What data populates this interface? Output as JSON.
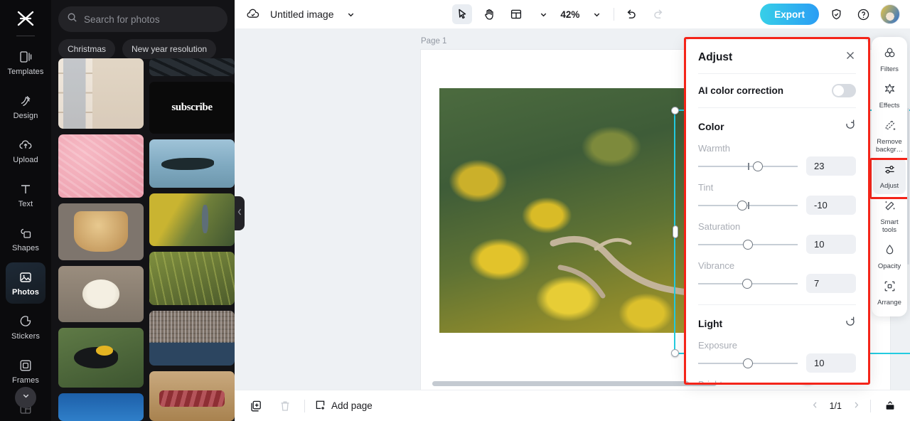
{
  "brand": {
    "logo_icon": "capcut-logo-icon"
  },
  "sidebar": {
    "items": [
      {
        "label": "Templates",
        "icon": "templates-icon",
        "active": false
      },
      {
        "label": "Design",
        "icon": "design-icon",
        "active": false
      },
      {
        "label": "Upload",
        "icon": "upload-cloud-icon",
        "active": false
      },
      {
        "label": "Text",
        "icon": "text-icon",
        "active": false
      },
      {
        "label": "Shapes",
        "icon": "shapes-icon",
        "active": false
      },
      {
        "label": "Photos",
        "icon": "photos-icon",
        "active": true
      },
      {
        "label": "Stickers",
        "icon": "stickers-icon",
        "active": false
      },
      {
        "label": "Frames",
        "icon": "frames-icon",
        "active": false
      }
    ],
    "more_icon": "chevron-down-icon"
  },
  "photo_panel": {
    "search": {
      "placeholder": "Search for photos",
      "icon": "search-icon"
    },
    "chips": [
      "Christmas",
      "New year resolution"
    ],
    "thumbnails_left": [
      {
        "name": "closet-wardrobe-photo"
      },
      {
        "name": "pink-texture-photo"
      },
      {
        "name": "bread-basket-photo"
      },
      {
        "name": "hummus-bowl-photo"
      },
      {
        "name": "oriole-bird-photo"
      },
      {
        "name": "blue-photo"
      }
    ],
    "thumbnails_right": [
      {
        "name": "keyboard-photo"
      },
      {
        "name": "subscribe-photo",
        "caption": "subscribe"
      },
      {
        "name": "cormorant-flying-photo"
      },
      {
        "name": "heron-branch-photo"
      },
      {
        "name": "reed-bird-photo"
      },
      {
        "name": "coastal-city-photo"
      },
      {
        "name": "salami-bread-photo"
      }
    ],
    "collapse_icon": "chevron-left-icon"
  },
  "topbar": {
    "cloud_icon": "cloud-saved-icon",
    "document_title": "Untitled image",
    "title_caret": "chevron-down-icon",
    "tools": [
      {
        "name": "select-tool",
        "icon": "cursor-arrow-icon",
        "active": true
      },
      {
        "name": "hand-tool",
        "icon": "hand-icon",
        "active": false
      },
      {
        "name": "layout-tool",
        "icon": "layout-icon",
        "active": false
      }
    ],
    "layout_caret": "chevron-down-icon",
    "zoom_level": "42%",
    "zoom_caret": "chevron-down-icon",
    "undo_icon": "undo-icon",
    "redo_icon": "redo-icon",
    "export_label": "Export",
    "shield_icon": "shield-check-icon",
    "help_icon": "help-circle-icon",
    "avatar": "user-avatar"
  },
  "canvas": {
    "page_label": "Page 1",
    "selected_image": "great-blue-heron-on-branch",
    "selection_color": "#23cbe0",
    "float_toolbar": [
      {
        "name": "crop-button",
        "icon": "crop-icon"
      },
      {
        "name": "replace-button",
        "icon": "replace-image-icon"
      },
      {
        "name": "duplicate-button",
        "icon": "duplicate-icon"
      },
      {
        "name": "more-button",
        "icon": "more-horizontal-icon"
      }
    ],
    "rotate_icon": "rotate-icon"
  },
  "adjust_panel": {
    "title": "Adjust",
    "close_icon": "close-icon",
    "highlight_color": "#f42419",
    "ai_color_correction": {
      "label": "AI color correction",
      "enabled": false
    },
    "sections": [
      {
        "title": "Color",
        "reset_icon": "reset-icon",
        "controls": [
          {
            "label": "Warmth",
            "value": "23",
            "pos": 60,
            "tick": true
          },
          {
            "label": "Tint",
            "value": "-10",
            "pos": 44,
            "tick": true
          },
          {
            "label": "Saturation",
            "value": "10",
            "pos": 50,
            "tick": false
          },
          {
            "label": "Vibrance",
            "value": "7",
            "pos": 49,
            "tick": false
          }
        ]
      },
      {
        "title": "Light",
        "reset_icon": "reset-icon",
        "controls": [
          {
            "label": "Exposure",
            "value": "10",
            "pos": 50,
            "tick": false
          },
          {
            "label": "Brightness",
            "value": "",
            "pos": 50,
            "tick": false
          }
        ]
      }
    ]
  },
  "right_toolbar": {
    "items": [
      {
        "label": "Filters",
        "icon": "filters-icon",
        "active": false
      },
      {
        "label": "Effects",
        "icon": "effects-icon",
        "active": false
      },
      {
        "label": "Remove\nbackgr…",
        "icon": "remove-bg-icon",
        "active": false
      },
      {
        "label": "Adjust",
        "icon": "adjust-icon",
        "active": true
      },
      {
        "label": "Smart\ntools",
        "icon": "smart-tools-icon",
        "active": false
      },
      {
        "label": "Opacity",
        "icon": "opacity-icon",
        "active": false
      },
      {
        "label": "Arrange",
        "icon": "arrange-icon",
        "active": false
      }
    ]
  },
  "bottombar": {
    "duplicate_page_icon": "duplicate-page-icon",
    "delete_page_icon": "trash-icon",
    "add_page_label": "Add page",
    "add_page_icon": "add-page-icon",
    "prev_icon": "chevron-left-icon",
    "page_indicator": "1/1",
    "next_icon": "chevron-right-icon",
    "present_icon": "present-icon"
  }
}
